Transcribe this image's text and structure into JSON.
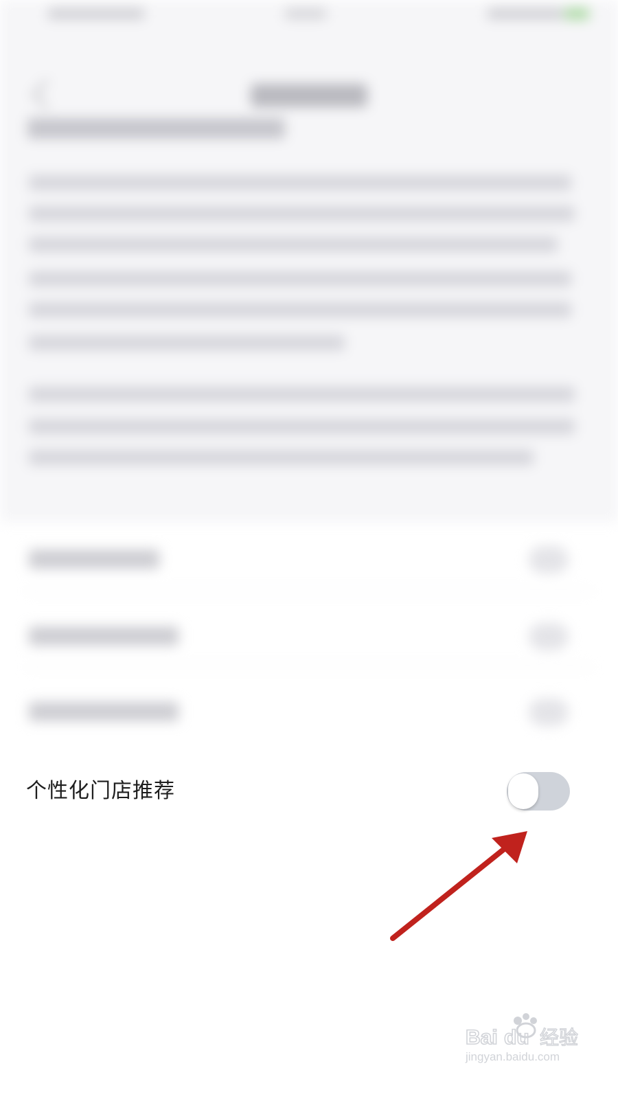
{
  "setting": {
    "label": "个性化门店推荐",
    "toggle_on": false
  },
  "colors": {
    "toggle_track": "#cfd3da",
    "toggle_knob": "#ffffff",
    "arrow": "#c0221d"
  },
  "watermark": {
    "brand": "Baidu经验",
    "url": "jingyan.baidu.com"
  }
}
